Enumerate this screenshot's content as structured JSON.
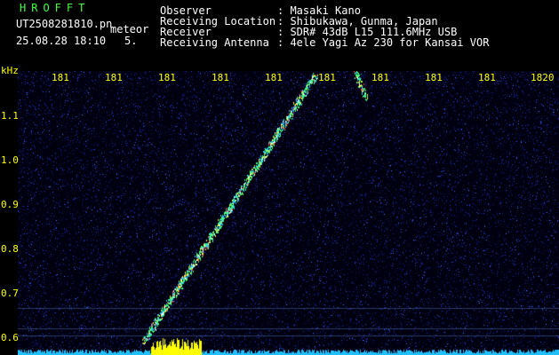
{
  "header": {
    "program": "HROFFT",
    "filename": "UT2508281810.pn",
    "event_type": "meteor",
    "datetime": "25.08.28 18:10",
    "count": "5.",
    "fields": [
      {
        "label": "Observer",
        "value": ": Masaki Kano"
      },
      {
        "label": "Receiving Location",
        "value": ": Shibukawa, Gunma, Japan"
      },
      {
        "label": "Receiver",
        "value": ": SDR# 43dB L15 111.6MHz USB"
      },
      {
        "label": "Receiving Antenna",
        "value": ": 4ele Yagi Az 230 for Kansai VOR"
      }
    ]
  },
  "axis": {
    "y_unit": "kHz",
    "y_ticks": [
      "1.1",
      "1.0",
      "0.9",
      "0.8",
      "0.7",
      "0.6"
    ],
    "x_ticks": [
      "181",
      "181",
      "181",
      "181",
      "181",
      "181",
      "181",
      "181",
      "181",
      "1820"
    ]
  },
  "colors": {
    "background": "#000000",
    "noise": "#1a2a9a",
    "trace": "#40ff80",
    "axis_text": "#ffff00",
    "header_text": "#ffffff",
    "title_text": "#3fff3f"
  }
}
